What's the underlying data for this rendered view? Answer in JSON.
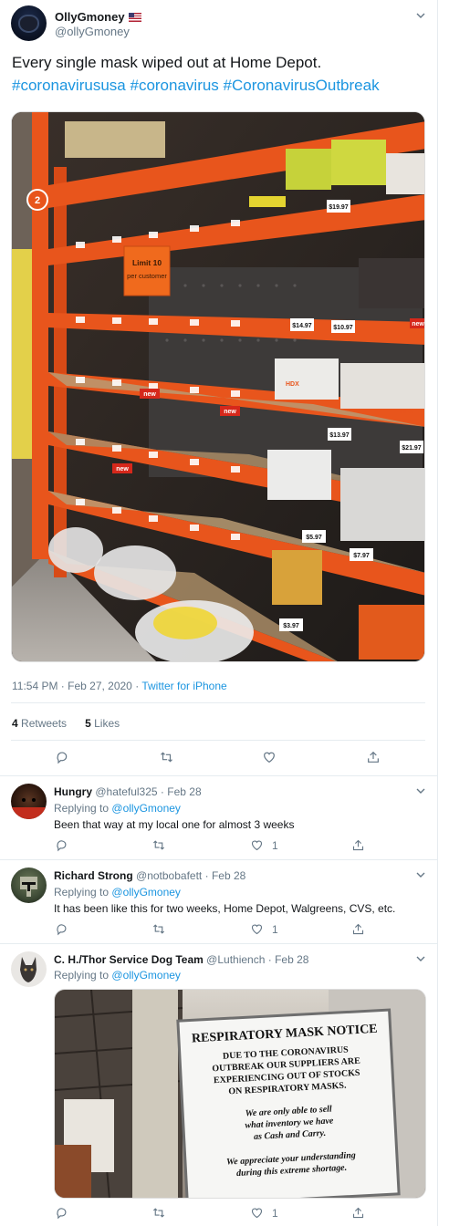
{
  "main_tweet": {
    "display_name": "OllyGmoney",
    "handle": "@ollyGmoney",
    "text": "Every single mask wiped out at Home Depot.",
    "hashtags": [
      "#coronavirususa",
      "#coronavirus",
      "#CoronavirusOutbreak"
    ],
    "timestamp": "11:54 PM · Feb 27, 2020",
    "separator": " · ",
    "source": "Twitter for iPhone",
    "retweets_count": "4",
    "retweets_label": "Retweets",
    "likes_count": "5",
    "likes_label": "Likes",
    "photo": {
      "shelf_sign": "Limit 10\nper customer",
      "aisle_marker": "2",
      "price_tags": [
        "$19.97",
        "$14.97",
        "$10.97",
        "$13.97",
        "$21.97",
        "$7.97",
        "$5.97",
        "$3.97"
      ],
      "new_tag": "new",
      "brand_tag": "HDX"
    }
  },
  "replies": [
    {
      "display_name": "Hungry",
      "handle": "@hateful325",
      "date": "Feb 28",
      "replying_prefix": "Replying to",
      "replying_to": "@ollyGmoney",
      "text": "Been that way at my local one for almost 3 weeks",
      "like_count": "1"
    },
    {
      "display_name": "Richard Strong",
      "handle": "@notbobafett",
      "date": "Feb 28",
      "replying_prefix": "Replying to",
      "replying_to": "@ollyGmoney",
      "text": "It has been like this for two weeks, Home Depot, Walgreens, CVS, etc.",
      "like_count": "1"
    },
    {
      "display_name": "C. H./Thor Service Dog Team",
      "handle": "@Luthiench",
      "date": "Feb 28",
      "replying_prefix": "Replying to",
      "replying_to": "@ollyGmoney",
      "like_count": "1",
      "photo": {
        "notice_title": "RESPIRATORY MASK NOTICE",
        "notice_lines": [
          "DUE TO THE CORONAVIRUS",
          "OUTBREAK OUR SUPPLIERS ARE",
          "EXPERIENCING OUT OF STOCKS",
          "ON RESPIRATORY MASKS."
        ],
        "notice_italic_1": [
          "We are only able to sell",
          "what inventory we have",
          "as Cash and Carry."
        ],
        "notice_italic_2": [
          "We appreciate your understanding",
          "during this extreme shortage."
        ]
      }
    }
  ],
  "icons": [
    "reply-icon",
    "retweet-icon",
    "like-icon",
    "share-icon",
    "chevron-down-icon"
  ],
  "colors": {
    "link": "#1b95e0",
    "muted": "#657786",
    "orange_shelf": "#e8551c",
    "divider": "#e6ecf0"
  }
}
